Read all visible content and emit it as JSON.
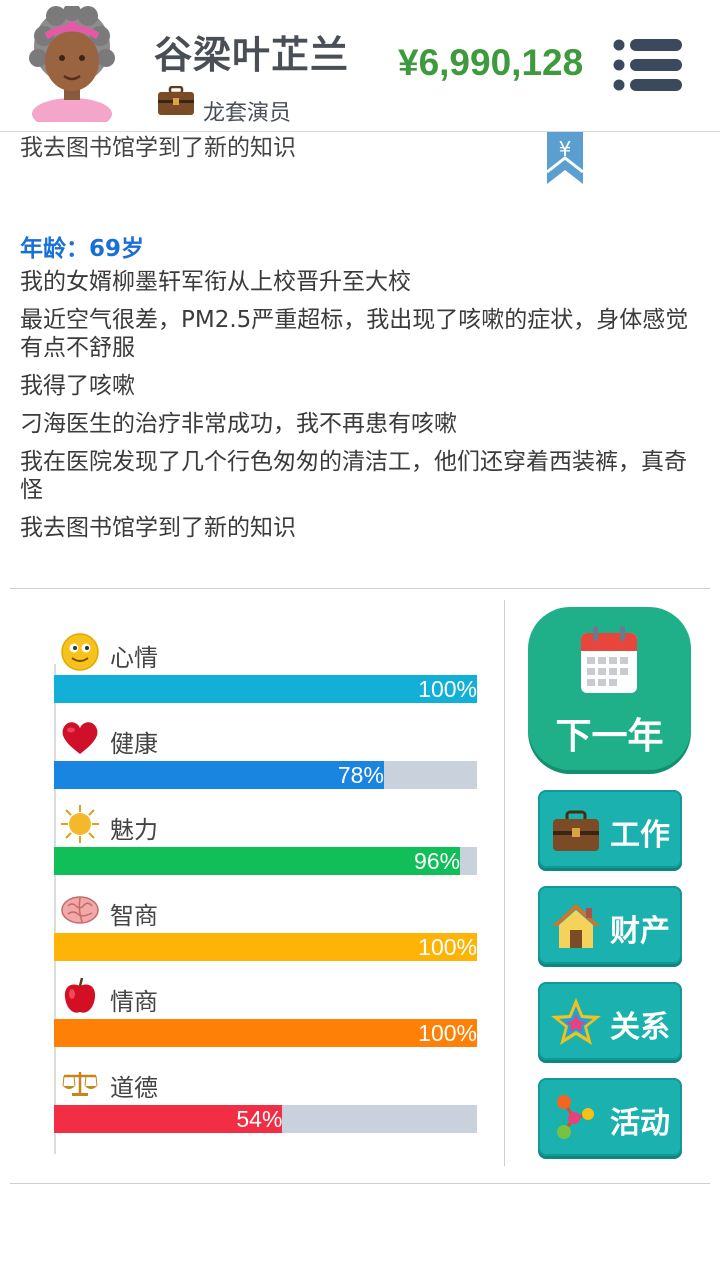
{
  "header": {
    "name": "谷梁叶芷兰",
    "job": "龙套演员",
    "money": "¥6,990,128"
  },
  "log": {
    "cut_line": "我去图书馆学到了新的知识",
    "bookmark_symbol": "¥",
    "age": "年龄：69岁",
    "lines": [
      "我的女婿柳墨轩军衔从上校晋升至大校",
      "最近空气很差，PM2.5严重超标，我出现了咳嗽的症状，身体感觉有点不舒服",
      "我得了咳嗽",
      "刁海医生的治疗非常成功，我不再患有咳嗽",
      "我在医院发现了几个行色匆匆的清洁工，他们还穿着西装裤，真奇怪",
      "我去图书馆学到了新的知识"
    ]
  },
  "stats": [
    {
      "label": "心情",
      "value": 100,
      "text": "100%",
      "color": "#12afd6",
      "icon": "smiley-icon"
    },
    {
      "label": "健康",
      "value": 78,
      "text": "78%",
      "color": "#1a85e0",
      "icon": "heart-icon"
    },
    {
      "label": "魅力",
      "value": 96,
      "text": "96%",
      "color": "#10bf57",
      "icon": "sun-icon"
    },
    {
      "label": "智商",
      "value": 100,
      "text": "100%",
      "color": "#fdb406",
      "icon": "brain-icon"
    },
    {
      "label": "情商",
      "value": 100,
      "text": "100%",
      "color": "#fe8006",
      "icon": "apple-icon"
    },
    {
      "label": "道德",
      "value": 54,
      "text": "54%",
      "color": "#f22e44",
      "icon": "scale-icon"
    }
  ],
  "buttons": {
    "next_year": "下一年",
    "work": "工作",
    "property": "财产",
    "relations": "关系",
    "activities": "活动"
  }
}
